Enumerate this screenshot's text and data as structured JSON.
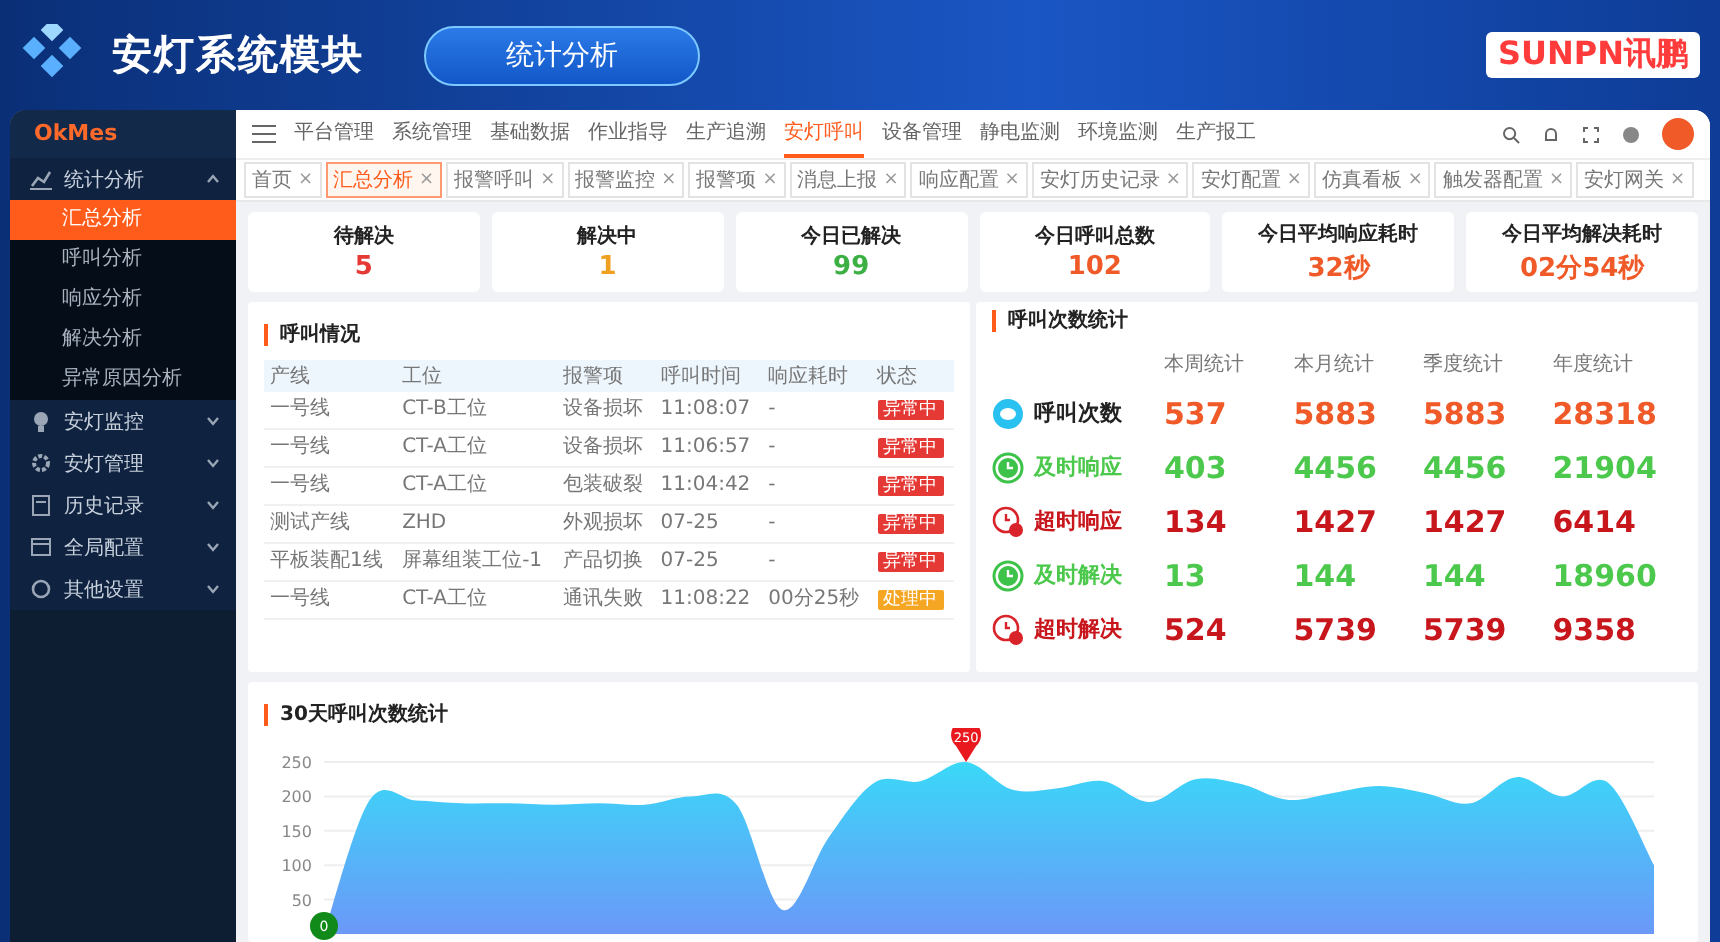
{
  "slide": {
    "title": "安灯系统模块",
    "section": "统计分析",
    "brand": "SUNPN讯鹏"
  },
  "sidebar": {
    "brand": "OkMes",
    "items": [
      {
        "label": "统计分析",
        "expanded": true,
        "children": [
          {
            "label": "汇总分析",
            "selected": true
          },
          {
            "label": "呼叫分析",
            "selected": false
          },
          {
            "label": "响应分析",
            "selected": false
          },
          {
            "label": "解决分析",
            "selected": false
          },
          {
            "label": "异常原因分析",
            "selected": false
          }
        ]
      },
      {
        "label": "安灯监控",
        "expanded": false
      },
      {
        "label": "安灯管理",
        "expanded": false
      },
      {
        "label": "历史记录",
        "expanded": false
      },
      {
        "label": "全局配置",
        "expanded": false
      },
      {
        "label": "其他设置",
        "expanded": false
      }
    ]
  },
  "menu": [
    {
      "label": "平台管理",
      "selected": false
    },
    {
      "label": "系统管理",
      "selected": false
    },
    {
      "label": "基础数据",
      "selected": false
    },
    {
      "label": "作业指导",
      "selected": false
    },
    {
      "label": "生产追溯",
      "selected": false
    },
    {
      "label": "安灯呼叫",
      "selected": true
    },
    {
      "label": "设备管理",
      "selected": false
    },
    {
      "label": "静电监测",
      "selected": false
    },
    {
      "label": "环境监测",
      "selected": false
    },
    {
      "label": "生产报工",
      "selected": false
    }
  ],
  "tabs": [
    {
      "label": "首页",
      "selected": false,
      "close": "×"
    },
    {
      "label": "汇总分析",
      "selected": true,
      "close": "×"
    },
    {
      "label": "报警呼叫",
      "selected": false,
      "close": "×"
    },
    {
      "label": "报警监控",
      "selected": false,
      "close": "×"
    },
    {
      "label": "报警项",
      "selected": false,
      "close": "×"
    },
    {
      "label": "消息上报",
      "selected": false,
      "close": "×"
    },
    {
      "label": "响应配置",
      "selected": false,
      "close": "×"
    },
    {
      "label": "安灯历史记录",
      "selected": false,
      "close": "×"
    },
    {
      "label": "安灯配置",
      "selected": false,
      "close": "×"
    },
    {
      "label": "仿真看板",
      "selected": false,
      "close": "×"
    },
    {
      "label": "触发器配置",
      "selected": false,
      "close": "×"
    },
    {
      "label": "安灯网关",
      "selected": false,
      "close": "×"
    }
  ],
  "summary": [
    {
      "label": "待解决",
      "value": "5",
      "color": "#e53935"
    },
    {
      "label": "解决中",
      "value": "1",
      "color": "#f0a020"
    },
    {
      "label": "今日已解决",
      "value": "99",
      "color": "#3cb043"
    },
    {
      "label": "今日呼叫总数",
      "value": "102",
      "color": "#f05a28"
    },
    {
      "label": "今日平均响应耗时",
      "value": "32秒",
      "color": "#f05a28"
    },
    {
      "label": "今日平均解决耗时",
      "value": "02分54秒",
      "color": "#f05a28"
    }
  ],
  "calls": {
    "title": "呼叫情况",
    "columns": [
      "产线",
      "工位",
      "报警项",
      "呼叫时间",
      "响应耗时",
      "状态"
    ],
    "rows": [
      {
        "cells": [
          "一号线",
          "CT-B工位",
          "设备损坏",
          "11:08:07",
          "-"
        ],
        "status": {
          "text": "异常中",
          "kind": "abnormal"
        }
      },
      {
        "cells": [
          "一号线",
          "CT-A工位",
          "设备损坏",
          "11:06:57",
          "-"
        ],
        "status": {
          "text": "异常中",
          "kind": "abnormal"
        }
      },
      {
        "cells": [
          "一号线",
          "CT-A工位",
          "包装破裂",
          "11:04:42",
          "-"
        ],
        "status": {
          "text": "异常中",
          "kind": "abnormal"
        }
      },
      {
        "cells": [
          "测试产线",
          "ZHD",
          "外观损坏",
          "07-25",
          "-"
        ],
        "status": {
          "text": "异常中",
          "kind": "abnormal"
        }
      },
      {
        "cells": [
          "平板装配1线",
          "屏幕组装工位-1",
          "产品切换",
          "07-25",
          "-"
        ],
        "status": {
          "text": "异常中",
          "kind": "abnormal"
        }
      },
      {
        "cells": [
          "一号线",
          "CT-A工位",
          "通讯失败",
          "11:08:22",
          "00分25秒"
        ],
        "status": {
          "text": "处理中",
          "kind": "processing"
        }
      }
    ]
  },
  "counts": {
    "title": "呼叫次数统计",
    "columns": [
      "本周统计",
      "本月统计",
      "季度统计",
      "年度统计"
    ],
    "rows": [
      {
        "label": "呼叫次数",
        "kind": "total",
        "color": "#f05a28",
        "values": [
          "537",
          "5883",
          "5883",
          "28318"
        ]
      },
      {
        "label": "及时响应",
        "kind": "ontime",
        "color": "#4cc94c",
        "values": [
          "403",
          "4456",
          "4456",
          "21904"
        ]
      },
      {
        "label": "超时响应",
        "kind": "overtime",
        "color": "#c8161d",
        "values": [
          "134",
          "1427",
          "1427",
          "6414"
        ]
      },
      {
        "label": "及时解决",
        "kind": "ontime",
        "color": "#4cc94c",
        "values": [
          "13",
          "144",
          "144",
          "18960"
        ]
      },
      {
        "label": "超时解决",
        "kind": "overtime",
        "color": "#c8161d",
        "values": [
          "524",
          "5739",
          "5739",
          "9358"
        ]
      }
    ]
  },
  "trend": {
    "title": "30天呼叫次数统计",
    "chart_data": {
      "type": "area",
      "ylim": [
        0,
        250
      ],
      "yticks": [
        50,
        100,
        150,
        200,
        250
      ],
      "grid": true,
      "series": [
        {
          "color": "#3ad8f8",
          "values": [
            0,
            195,
            194,
            190,
            190,
            188,
            190,
            188,
            200,
            188,
            35,
            140,
            220,
            222,
            250,
            210,
            212,
            222,
            192,
            225,
            218,
            195,
            205,
            215,
            205,
            190,
            228,
            200,
            220,
            100
          ]
        }
      ],
      "annotations": [
        {
          "text": "250",
          "y": 250
        },
        {
          "text": "0",
          "y": 0
        }
      ]
    }
  }
}
